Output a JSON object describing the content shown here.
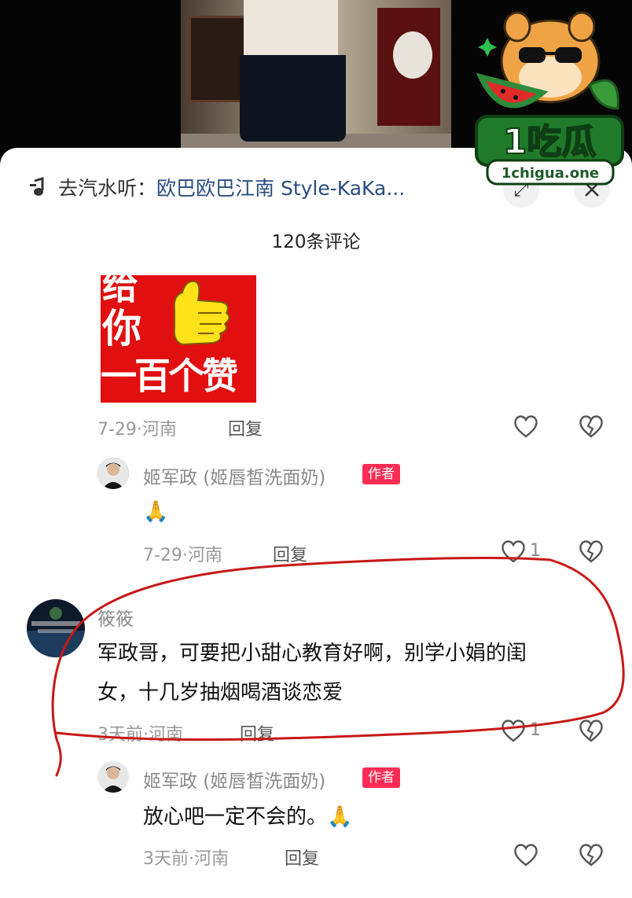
{
  "watermark": {
    "brand": "1吃瓜",
    "url": "1chigua.one"
  },
  "header": {
    "music_prefix": "去汽水听：",
    "song_title": "欧巴欧巴江南 Style-KaKa...",
    "comment_count": "120条评论",
    "close_icon": "close-icon",
    "music_icon": "music-note-icon"
  },
  "comments": [
    {
      "sticker_text": [
        "给",
        "你",
        "一百个赞"
      ],
      "meta": "7-29·河南",
      "reply_label": "回复",
      "likes": ""
    },
    {
      "username": "姬军政 (姬唇皙洗面奶)",
      "badge": "作者",
      "text": "🙏",
      "meta": "7-29·河南",
      "reply_label": "回复",
      "likes": "1"
    },
    {
      "username": "筱筱",
      "text_lines": [
        "军政哥，可要把小甜心教育好啊，别学小娟的闺",
        "女，十几岁抽烟喝酒谈恋爱"
      ],
      "meta": "3天前·河南",
      "reply_label": "回复",
      "likes": "1"
    },
    {
      "username": "姬军政 (姬唇皙洗面奶)",
      "badge": "作者",
      "text": "放心吧一定不会的。🙏",
      "meta": "3天前·河南",
      "reply_label": "回复",
      "likes": ""
    }
  ],
  "colors": {
    "author_badge": "#fe2c55",
    "annotation_stroke": "#c81818",
    "sticker_bg": "#e10f0f"
  }
}
